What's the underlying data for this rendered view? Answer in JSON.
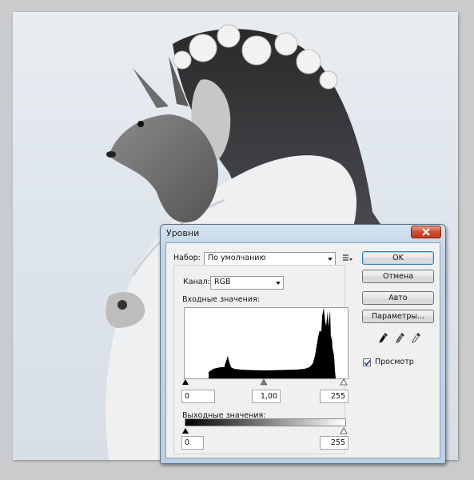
{
  "dialog": {
    "title": "Уровни",
    "preset_label": "Набор:",
    "preset_value": "По умолчанию",
    "channel_label": "Канал:",
    "channel_value": "RGB",
    "input_levels_label": "Входные значения:",
    "input_black": "0",
    "input_gamma": "1,00",
    "input_white": "255",
    "output_levels_label": "Выходные значения:",
    "output_black": "0",
    "output_white": "255",
    "buttons": {
      "ok": "OK",
      "cancel": "Отмена",
      "auto": "Авто",
      "options": "Параметры..."
    },
    "preview_label": "Просмотр",
    "preview_checked": true
  },
  "colors": {
    "close_button": "#cf4b31",
    "default_button_border": "#3c7fb1",
    "histogram_fill": "#000000"
  },
  "icons": [
    "close-icon",
    "preset-menu-icon",
    "black-eyedropper-icon",
    "gray-eyedropper-icon",
    "white-eyedropper-icon",
    "checkmark-icon"
  ]
}
